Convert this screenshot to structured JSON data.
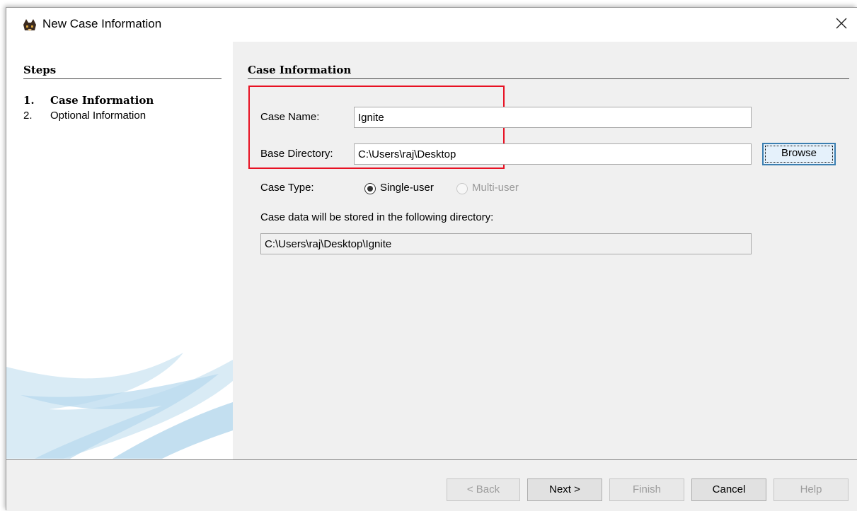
{
  "window": {
    "title": "New Case Information"
  },
  "steps": {
    "heading": "Steps",
    "items": [
      {
        "num": "1.",
        "label": "Case Information"
      },
      {
        "num": "2.",
        "label": "Optional Information"
      }
    ]
  },
  "main": {
    "heading": "Case Information",
    "case_name_label": "Case Name:",
    "case_name_value": "Ignite",
    "base_dir_label": "Base Directory:",
    "base_dir_value": "C:\\Users\\raj\\Desktop",
    "browse_label": "Browse",
    "case_type_label": "Case Type:",
    "single_user_label": "Single-user",
    "multi_user_label": "Multi-user",
    "case_type_selected": "Single-user",
    "storage_note": "Case data will be stored in the following directory:",
    "storage_path": "C:\\Users\\raj\\Desktop\\Ignite"
  },
  "footer": {
    "back_label": "< Back",
    "next_label": "Next >",
    "finish_label": "Finish",
    "cancel_label": "Cancel",
    "help_label": "Help"
  },
  "colors": {
    "highlight": "#e81123",
    "focus_border": "#3c7fb1",
    "panel_bg": "#f0f0f0"
  },
  "icons": {
    "app": "autopsy-dog-icon",
    "close": "close-icon"
  }
}
